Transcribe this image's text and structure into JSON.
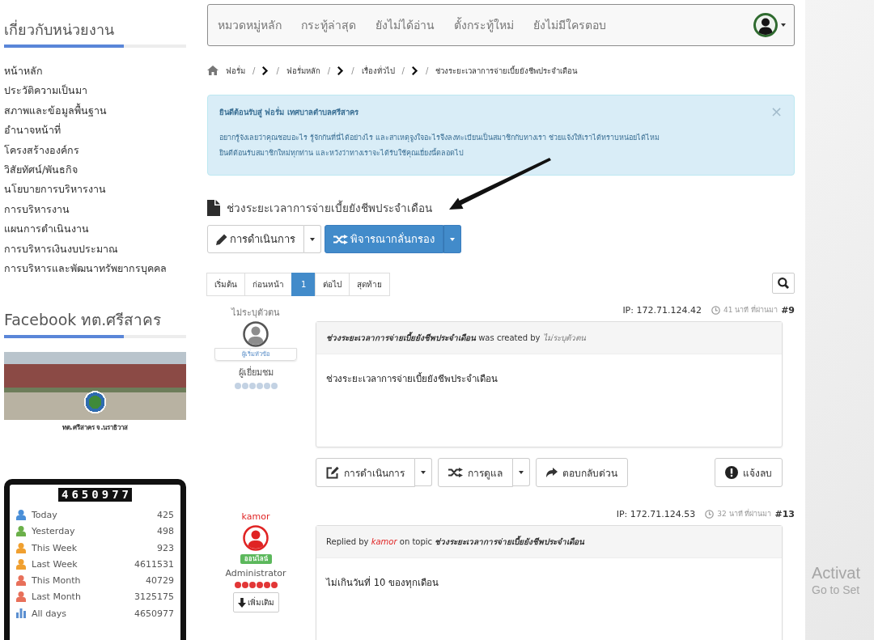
{
  "sidebar": {
    "about": {
      "title": "เกี่ยวกับหน่วยงาน",
      "links": [
        "หน้าหลัก",
        "ประวัติความเป็นมา",
        "สภาพและข้อมูลพื้นฐาน",
        "อำนาจหน้าที่",
        "โครงสร้างองค์กร",
        "วิสัยทัศน์/พันธกิจ",
        "นโยบายการบริหารงาน",
        "การบริหารงาน",
        "แผนการดำเนินงาน",
        "การบริหารเงินงบประมาณ",
        "การบริหารและพัฒนาทรัพยากรบุคคล"
      ]
    },
    "facebook": {
      "title": "Facebook ทต.ศรีสาคร",
      "caption": "ทต.ศรีสาคร จ.นราธิวาส"
    },
    "counter": {
      "total": "4650977",
      "rows": [
        {
          "kind": "person",
          "color": "#4a8fd8",
          "label": "Today",
          "value": "425"
        },
        {
          "kind": "person",
          "color": "#6bb04a",
          "label": "Yesterday",
          "value": "498"
        },
        {
          "kind": "person",
          "color": "#f0a030",
          "label": "This Week",
          "value": "923"
        },
        {
          "kind": "person",
          "color": "#f0a030",
          "label": "Last Week",
          "value": "4611531"
        },
        {
          "kind": "person",
          "color": "#e8705a",
          "label": "This Month",
          "value": "40729"
        },
        {
          "kind": "person",
          "color": "#e8705a",
          "label": "Last Month",
          "value": "3125175"
        },
        {
          "kind": "chart",
          "color": "#5b8fd0",
          "label": "All days",
          "value": "4650977"
        }
      ]
    }
  },
  "navbar": {
    "items": [
      "หมวดหมู่หลัก",
      "กระทู้ล่าสุด",
      "ยังไม่ได้อ่าน",
      "ตั้งกระทู้ใหม่",
      "ยังไม่มีใครตอบ"
    ]
  },
  "breadcrumb": [
    {
      "kind": "home"
    },
    {
      "kind": "link",
      "label": "ฟอรั่ม"
    },
    {
      "kind": "separator",
      "label": "/"
    },
    {
      "kind": "chevron"
    },
    {
      "kind": "separator",
      "label": "/"
    },
    {
      "kind": "link",
      "label": "ฟอรั่มหลัก"
    },
    {
      "kind": "separator",
      "label": "/"
    },
    {
      "kind": "chevron"
    },
    {
      "kind": "separator",
      "label": "/"
    },
    {
      "kind": "link",
      "label": "เรื่องทั่วไป"
    },
    {
      "kind": "separator",
      "label": "/"
    },
    {
      "kind": "chevron"
    },
    {
      "kind": "separator",
      "label": "/"
    },
    {
      "kind": "current",
      "label": "ช่วงระยะเวลาการจ่ายเบี้ยยังชีพประจำเดือน"
    }
  ],
  "alert": {
    "title": "ยินดีต้อนรับสู่ ฟอรั่ม เทศบาลตำบลศรีสาคร",
    "close": "×",
    "lines": [
      "อยากรู้จังเลยว่าคุณชอบอะไร รู้จักกันที่นี่ได้อย่างไร และสาเหตุจูงใจอะไรจึงลงทะเบียนเป็นสมาชิกกับทางเรา ช่วยแจ้งให้เราได้ทราบหน่อยได้ไหม",
      "ยินดีต้อนรับสมาชิกใหม่ทุกท่าน และหวังว่าทางเราจะได้รับใช้คุณเยี่ยงนี้ตลอดไป"
    ]
  },
  "topic": {
    "title": "ช่วงระยะเวลาการจ่ายเบี้ยยังชีพประจำเดือน",
    "actions": [
      {
        "kind": "edit",
        "label": "การดำเนินการ",
        "primary": false,
        "dropdown": true
      },
      {
        "kind": "moderate",
        "label": "พิจารณากลั่นกรอง",
        "primary": true,
        "dropdown": true
      }
    ]
  },
  "pagination": {
    "pages": [
      {
        "label": "เริ่มต้น",
        "selected": false
      },
      {
        "label": "ก่อนหน้า",
        "selected": false
      },
      {
        "label": "1",
        "selected": true
      },
      {
        "label": "ต่อไป",
        "selected": false
      },
      {
        "label": "สุดท้าย",
        "selected": false
      }
    ]
  },
  "posts": [
    {
      "ip": "IP: 172.71.124.42",
      "time": "41 นาที ที่ผ่านมา",
      "number": "#9",
      "user": {
        "kind": "guest",
        "name": "ไม่ระบุตัวตน",
        "badge": {
          "kind": "topic-starter",
          "label": "ผู้เริ่มหัวข้อ"
        },
        "role": "ผู้เยี่ยมชม",
        "stars": 6
      },
      "header": [
        {
          "kind": "topic",
          "text": "ช่วงระยะเวลาการจ่ายเบี้ยยังชีพประจำเดือน"
        },
        {
          "kind": "text",
          "text": "was created by"
        },
        {
          "kind": "user",
          "text": "ไม่ระบุตัวตน"
        }
      ],
      "body": "ช่วงระยะเวลาการจ่ายเบี้ยยังชีพประจำเดือน",
      "actions": [
        {
          "kind": "edit",
          "label": "การดำเนินการ",
          "dropdown": true
        },
        {
          "kind": "moderate",
          "label": "การดูแล",
          "dropdown": true
        },
        {
          "kind": "reply",
          "label": "ตอบกลับด่วน",
          "dropdown": false
        },
        {
          "kind": "report",
          "label": "แจ้งลบ",
          "dropdown": false
        }
      ]
    },
    {
      "ip": "IP: 172.71.124.53",
      "time": "32 นาที ที่ผ่านมา",
      "number": "#13",
      "user": {
        "kind": "admin",
        "name": "kamor",
        "badge": {
          "kind": "online",
          "label": "ออนไลน์"
        },
        "role": "Administrator",
        "stars": 6,
        "more": "เพิ่มเติม"
      },
      "header": [
        {
          "kind": "text",
          "text": "Replied by"
        },
        {
          "kind": "user",
          "text": "kamor"
        },
        {
          "kind": "text",
          "text": "on topic"
        },
        {
          "kind": "topic",
          "text": "ช่วงระยะเวลาการจ่ายเบี้ยยังชีพประจำเดือน"
        }
      ],
      "body": "ไม่เกินวันที่ 10 ของทุกเดือน"
    }
  ],
  "os_notice": {
    "title": "Activat",
    "subtitle": "Go to Set"
  }
}
